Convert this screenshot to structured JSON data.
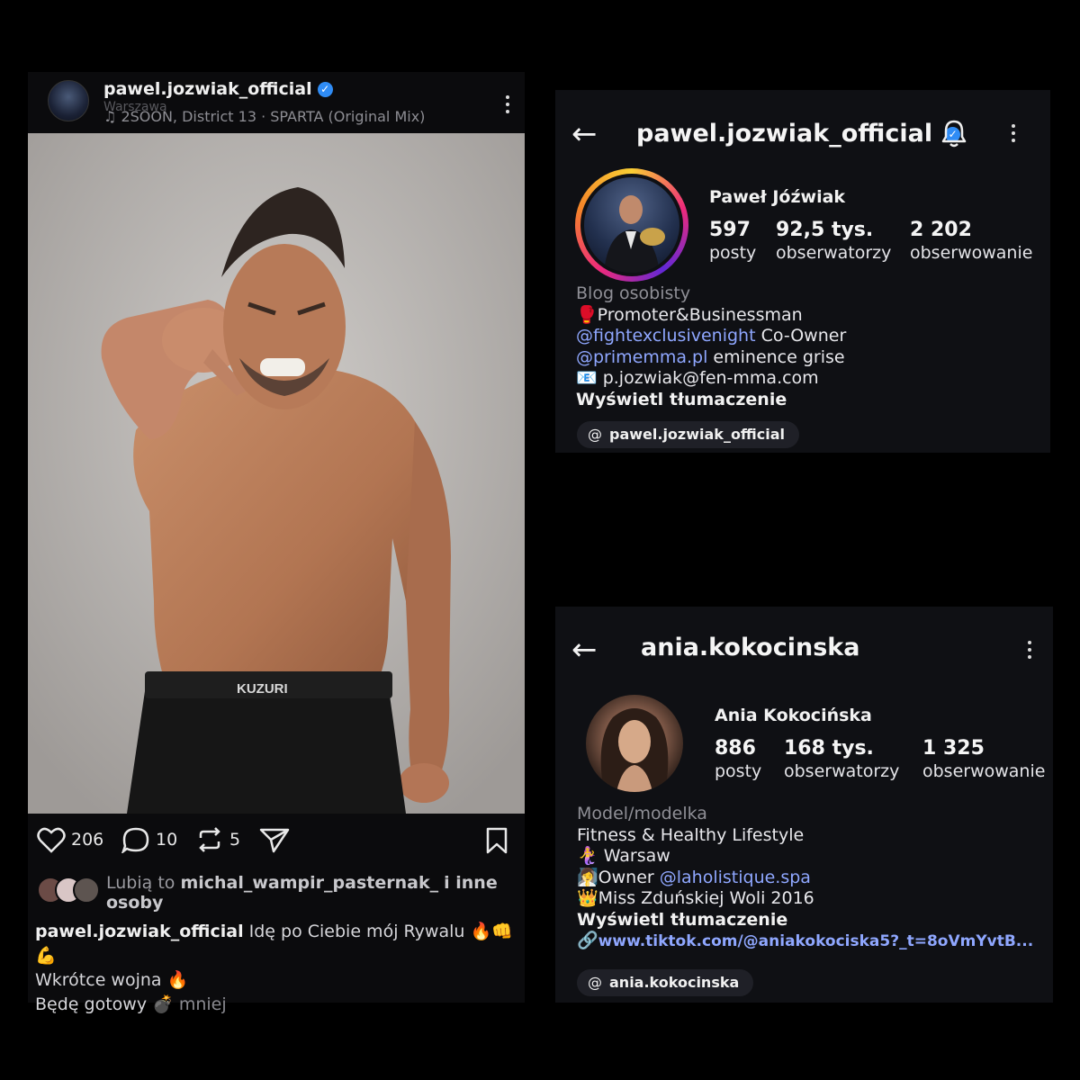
{
  "post": {
    "username": "pawel.jozwiak_official",
    "location": "Warszawa",
    "audio": "2SOON, District 13 · SPARTA (Original Mix)",
    "photo_brand": "KUZURI",
    "likes_count": "206",
    "comments_count": "10",
    "reposts_count": "5",
    "liked_by_prefix": "Lubią to",
    "liked_by_user": "michal_wampir_pasternak_",
    "liked_by_suffix": "i inne osoby",
    "caption_user": "pawel.jozwiak_official",
    "caption_line1": "Idę po Ciebie mój Rywalu 🔥👊💪",
    "caption_line2": "Wkrótce wojna 🔥",
    "caption_line3": "Będę gotowy 💣",
    "less_label": "mniej"
  },
  "profile1": {
    "handle": "pawel.jozwiak_official",
    "full_name": "Paweł Jóźwiak",
    "stats": [
      {
        "value": "597",
        "label": "posty"
      },
      {
        "value": "92,5 tys.",
        "label": "obserwatorzy"
      },
      {
        "value": "2 202",
        "label": "obserwowanie"
      }
    ],
    "category": "Blog osobisty",
    "bio_line1": "🥊Promoter&Businessman",
    "bio_link1": "@fightexclusivenight",
    "bio_line2_suffix": " Co-Owner",
    "bio_link2": "@primemma.pl",
    "bio_line3_suffix": " eminence grise",
    "bio_email": "📧 p.jozwiak@fen-mma.com",
    "translate_label": "Wyświetl tłumaczenie",
    "threads_handle": "pawel.jozwiak_official"
  },
  "profile2": {
    "handle": "ania.kokocinska",
    "full_name": "Ania Kokocińska",
    "stats": [
      {
        "value": "886",
        "label": "posty"
      },
      {
        "value": "168 tys.",
        "label": "obserwatorzy"
      },
      {
        "value": "1 325",
        "label": "obserwowanie"
      }
    ],
    "category": "Model/modelka",
    "bio_line1": "Fitness & Healthy Lifestyle",
    "bio_line2": "🧜‍♀️ Warsaw",
    "bio_line3_prefix": "🧖‍♀️Owner ",
    "bio_link": "@laholistique.spa",
    "bio_line4": "👑Miss Zduńskiej Woli 2016",
    "translate_label": "Wyświetl tłumaczenie",
    "website": "www.tiktok.com/@aniakokociska5?_t=8oVmYvtB...",
    "threads_handle": "ania.kokocinska"
  },
  "colors": {
    "background": "#000000",
    "panel": "#0f1014",
    "link": "#8fa7ff",
    "verified": "#2f8cf5"
  }
}
